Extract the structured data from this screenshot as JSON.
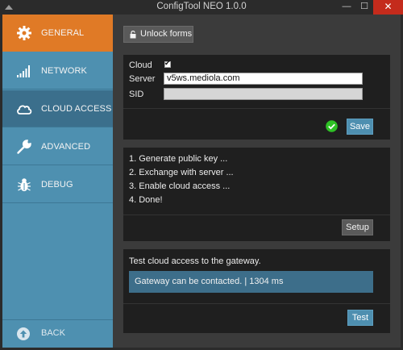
{
  "window": {
    "title": "ConfigTool NEO 1.0.0",
    "min_glyph": "—",
    "max_glyph": "☐",
    "close_glyph": "✕",
    "icon": "app-logo-icon"
  },
  "sidebar": {
    "items": [
      {
        "label": "GENERAL",
        "icon": "gear-icon",
        "color": "#e07a26"
      },
      {
        "label": "NETWORK",
        "icon": "signal-bars-icon"
      },
      {
        "label": "CLOUD ACCESS",
        "icon": "cloud-icon",
        "color": "#3b6f8c"
      },
      {
        "label": "ADVANCED",
        "icon": "wrench-icon"
      },
      {
        "label": "DEBUG",
        "icon": "bug-icon"
      }
    ],
    "back": {
      "label": "BACK",
      "icon": "arrow-up-circle-icon"
    }
  },
  "toolbar": {
    "unlock_label": "Unlock forms",
    "unlock_icon": "lock-icon"
  },
  "cloud_form": {
    "cloud_label": "Cloud",
    "cloud_checked": true,
    "server_label": "Server",
    "server_value": "v5ws.mediola.com",
    "sid_label": "SID",
    "sid_value": "",
    "save_label": "Save",
    "ok_icon": "check-circle-icon",
    "ok_color": "#2ec125"
  },
  "setup_panel": {
    "steps": [
      "1. Generate public key ...",
      "2. Exchange with server ...",
      "3. Enable cloud access ...",
      "4. Done!"
    ],
    "setup_label": "Setup"
  },
  "test_panel": {
    "description": "Test cloud access to the gateway.",
    "status": "Gateway can be contacted. | 1304 ms",
    "test_label": "Test"
  },
  "colors": {
    "accent_orange": "#e07a26",
    "sidebar_blue": "#4e90b0",
    "button_blue": "#4e8fb0",
    "panel_bg": "#1f1f1f"
  }
}
